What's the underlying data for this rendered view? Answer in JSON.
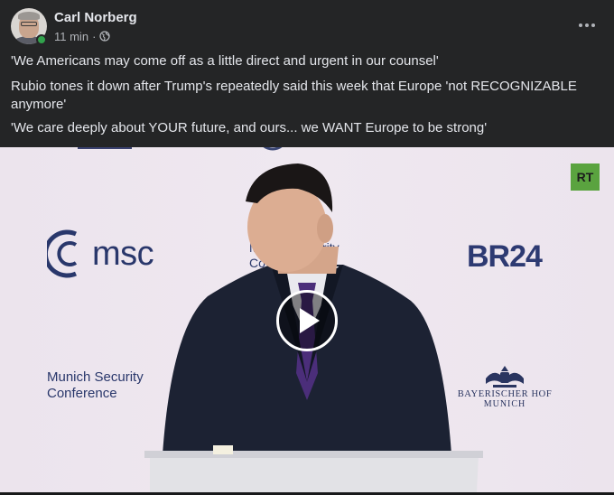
{
  "post": {
    "author": "Carl Norberg",
    "time": "11 min",
    "separator": "·",
    "privacy_icon": "globe-icon",
    "more_icon": "more-options-icon",
    "online": true,
    "lines": [
      "'We Americans may come off as a little direct and urgent in our counsel'",
      "Rubio tones it down after Trump's repeatedly said this week that Europe 'not RECOGNIZABLE anymore'",
      "'We care deeply about YOUR future, and ours... we WANT Europe to be strong'"
    ]
  },
  "video": {
    "msc_logo": "msc",
    "backdrop_partial_text": "Munich Security Conference",
    "munich_line1": "Munich Security",
    "munich_line2": "Conference",
    "br_logo": "BR24",
    "hof_line1": "BAYERISCHER HOF",
    "hof_line2": "MUNICH",
    "watermark": "RT",
    "play_icon": "play-icon"
  },
  "colors": {
    "background": "#242526",
    "text_primary": "#e4e6eb",
    "text_secondary": "#b0b3b8",
    "online": "#31a24c",
    "rt_green": "#5aa33f",
    "msc_blue": "#29376b"
  }
}
